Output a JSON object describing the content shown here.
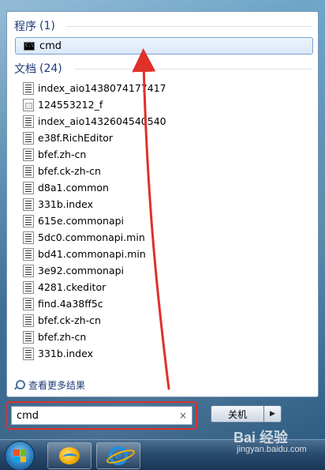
{
  "programs": {
    "header": "程序",
    "count": "(1)",
    "items": [
      {
        "label": "cmd",
        "icon": "cmd-console-icon"
      }
    ]
  },
  "documents": {
    "header": "文档",
    "count": "(24)",
    "items": [
      {
        "label": "index_aio1438074177417"
      },
      {
        "label": "124553212_f"
      },
      {
        "label": "index_aio1432604540540"
      },
      {
        "label": "e38f.RichEditor"
      },
      {
        "label": "bfef.zh-cn"
      },
      {
        "label": "bfef.ck-zh-cn"
      },
      {
        "label": "d8a1.common"
      },
      {
        "label": "331b.index"
      },
      {
        "label": "615e.commonapi"
      },
      {
        "label": "5dc0.commonapi.min"
      },
      {
        "label": "bd41.commonapi.min"
      },
      {
        "label": "3e92.commonapi"
      },
      {
        "label": "4281.ckeditor"
      },
      {
        "label": "find.4a38ff5c"
      },
      {
        "label": "bfef.ck-zh-cn"
      },
      {
        "label": "bfef.zh-cn"
      },
      {
        "label": "331b.index"
      }
    ]
  },
  "more_results": "查看更多结果",
  "search": {
    "value": "cmd",
    "clear_label": "×"
  },
  "shutdown": {
    "label": "关机",
    "arrow": "▶"
  },
  "watermark": {
    "brand": "Bai 经验",
    "url": "jingyan.baidu.com"
  },
  "colors": {
    "annotation": "#e0302a",
    "group_header": "#1e3a78"
  }
}
